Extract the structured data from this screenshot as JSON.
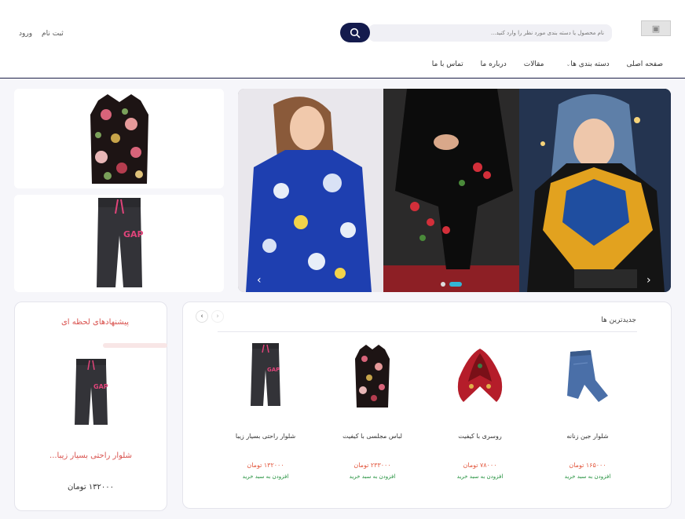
{
  "header": {
    "logo_text": "▣",
    "search_placeholder": "نام محصول یا دسته بندی مورد نظر را وارد کنید...",
    "auth": {
      "register": "ثبت نام",
      "login": "ورود"
    },
    "nav": [
      {
        "label": "صفحه اصلی"
      },
      {
        "label": "دسته بندی ها",
        "caret": "⌄"
      },
      {
        "label": "مقالات"
      },
      {
        "label": "درباره ما"
      },
      {
        "label": "تماس با ما"
      }
    ]
  },
  "slider": {
    "prev_icon": "‹",
    "next_icon": "›",
    "dots": 2,
    "active_dot": 1
  },
  "offer": {
    "title": "پیشنهادهای لحظه ای",
    "product_name": "شلوار راحتی بسیار زیبا...",
    "product_price": "۱۳۲۰۰۰ تومان"
  },
  "latest": {
    "title": "جدیدترین ها",
    "prev_icon": "‹",
    "next_icon": "›",
    "products": [
      {
        "name": "شلوار جین زنانه",
        "price": "۱۶۵۰۰۰ تومان",
        "add": "افزودن به سبد خرید",
        "icon": "jeans-icon"
      },
      {
        "name": "روسری با کیفیت",
        "price": "۷۸۰۰۰ تومان",
        "add": "افزودن به سبد خرید",
        "icon": "scarf-icon"
      },
      {
        "name": "لباس مجلسی با کیفیت",
        "price": "۲۳۳۰۰۰ تومان",
        "add": "افزودن به سبد خرید",
        "icon": "floral-blouse-icon"
      },
      {
        "name": "شلوار راحتی بسیار زیبا",
        "price": "۱۳۲۰۰۰ تومان",
        "add": "افزودن به سبد خرید",
        "icon": "sweatpants-icon"
      }
    ]
  },
  "colors": {
    "brand_navy": "#141b4d",
    "accent_red": "#d9534f",
    "price_red": "#e2553b",
    "add_green": "#1f8f3a",
    "dot_active": "#33b5d5"
  }
}
